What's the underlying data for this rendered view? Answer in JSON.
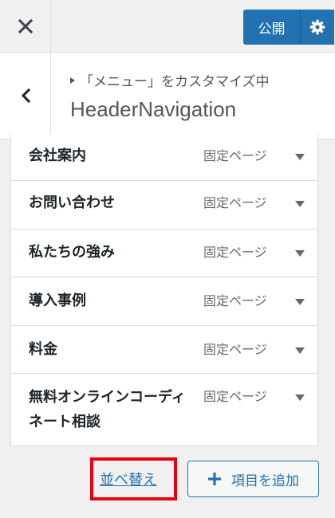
{
  "header": {
    "close_icon": "close-icon",
    "publish_label": "公開",
    "settings_icon": "gear-icon",
    "brand_color": "#2271b1"
  },
  "section": {
    "back_icon": "chevron-left-icon",
    "breadcrumb": "「メニュー」をカスタマイズ中",
    "title": "HeaderNavigation"
  },
  "menu_items": [
    {
      "title": "会社案内",
      "type": "固定ページ"
    },
    {
      "title": "お問い合わせ",
      "type": "固定ページ"
    },
    {
      "title": "私たちの強み",
      "type": "固定ページ"
    },
    {
      "title": "導入事例",
      "type": "固定ページ"
    },
    {
      "title": "料金",
      "type": "固定ページ"
    },
    {
      "title": "無料オンラインコーディネート相談",
      "type": "固定ページ"
    }
  ],
  "actions": {
    "reorder_label": "並べ替え",
    "add_item_label": "項目を追加",
    "highlight_color": "#e60012"
  }
}
